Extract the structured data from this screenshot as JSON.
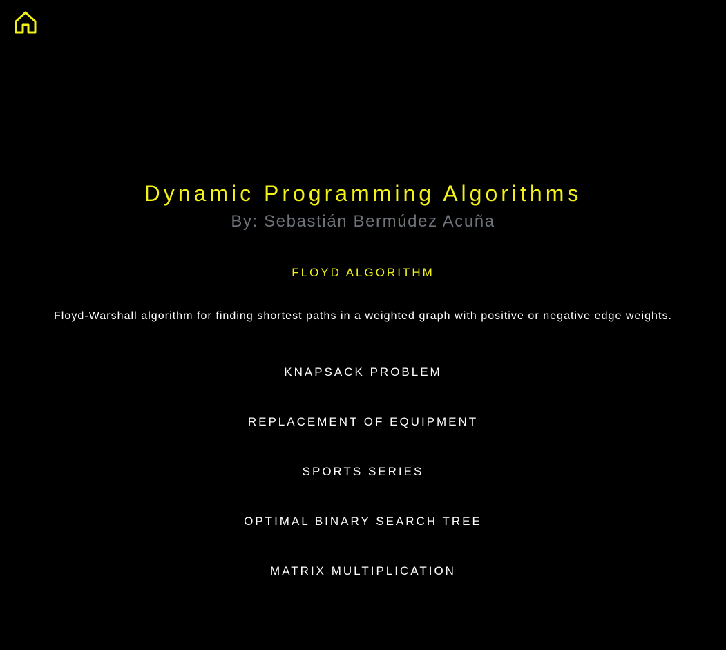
{
  "header": {
    "home_icon": "home-icon",
    "accent_color": "#f2f21a"
  },
  "title": "Dynamic Programming Algorithms",
  "author": "By: Sebastián Bermúdez Acuña",
  "algorithms": [
    {
      "label": "FLOYD ALGORITHM",
      "active": true,
      "description": "Floyd-Warshall algorithm for finding shortest paths in a weighted graph with positive or negative edge weights."
    },
    {
      "label": "KNAPSACK PROBLEM",
      "active": false
    },
    {
      "label": "REPLACEMENT OF EQUIPMENT",
      "active": false
    },
    {
      "label": "SPORTS SERIES",
      "active": false
    },
    {
      "label": "OPTIMAL BINARY SEARCH TREE",
      "active": false
    },
    {
      "label": "MATRIX MULTIPLICATION",
      "active": false
    }
  ],
  "colors": {
    "background": "#000000",
    "title": "#f2f21a",
    "active_item": "#f2f21a",
    "item": "#ffffff",
    "author": "#6e737a"
  }
}
